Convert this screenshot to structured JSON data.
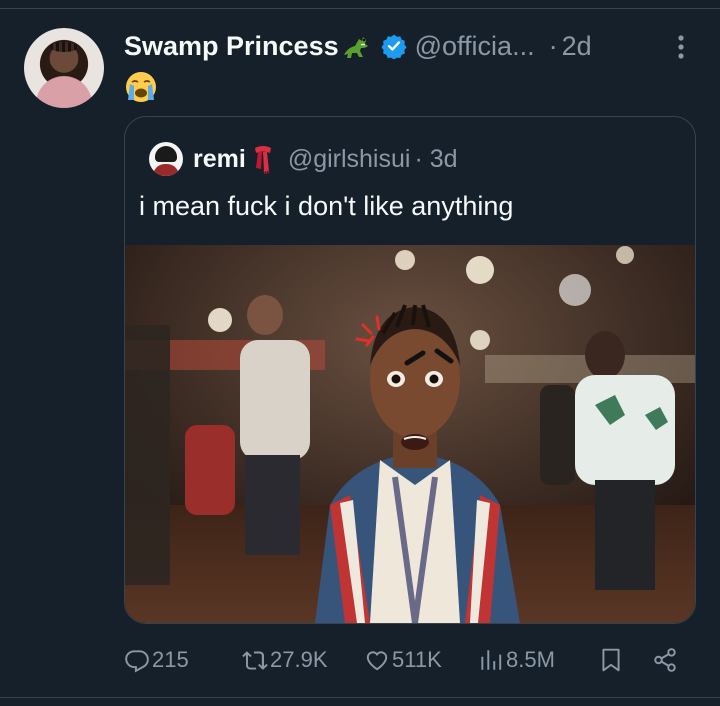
{
  "tweet": {
    "author_name": "Swamp Princess",
    "author_emoji": "crocodile-emoji",
    "verified_icon": "verified-badge-icon",
    "handle": "@officia...",
    "time_sep": "·",
    "time": "2d",
    "text_emoji": "loudly-crying-face-emoji"
  },
  "quote": {
    "author_name": "remi",
    "author_emoji": "scarf-emoji",
    "handle": "@girlshisui",
    "time": "· 3d",
    "text": "i mean fuck i don't like anything"
  },
  "actions": {
    "replies": "215",
    "reposts": "27.9K",
    "likes": "511K",
    "views": "8.5M"
  },
  "colors": {
    "background": "#15202b",
    "text": "#f7f9f9",
    "muted": "#8b98a5",
    "border": "#38444d",
    "verified": "#1d9bf0"
  }
}
